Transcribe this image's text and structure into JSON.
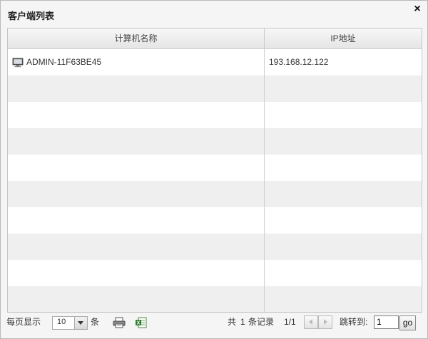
{
  "dialog": {
    "title": "客户端列表",
    "close_glyph": "×"
  },
  "table": {
    "columns": [
      "计算机名称",
      "IP地址"
    ],
    "rows": [
      {
        "name": "ADMIN-11F63BE45",
        "ip": "193.168.12.122",
        "icon": "computer-icon"
      }
    ]
  },
  "footer": {
    "per_page_label": "每页显示",
    "per_page_value": "10",
    "per_page_unit": "条",
    "total_prefix": "共",
    "total_count": "1",
    "total_suffix": "条记录",
    "page_indicator": "1/1",
    "jump_label": "跳转到:",
    "jump_value": "1",
    "go_label": "go",
    "print_icon": "printer-icon",
    "export_icon": "excel-export-icon"
  },
  "colors": {
    "header_bg": "#e9e9e9",
    "row_alt": "#efefef",
    "border": "#c6c6c6"
  }
}
